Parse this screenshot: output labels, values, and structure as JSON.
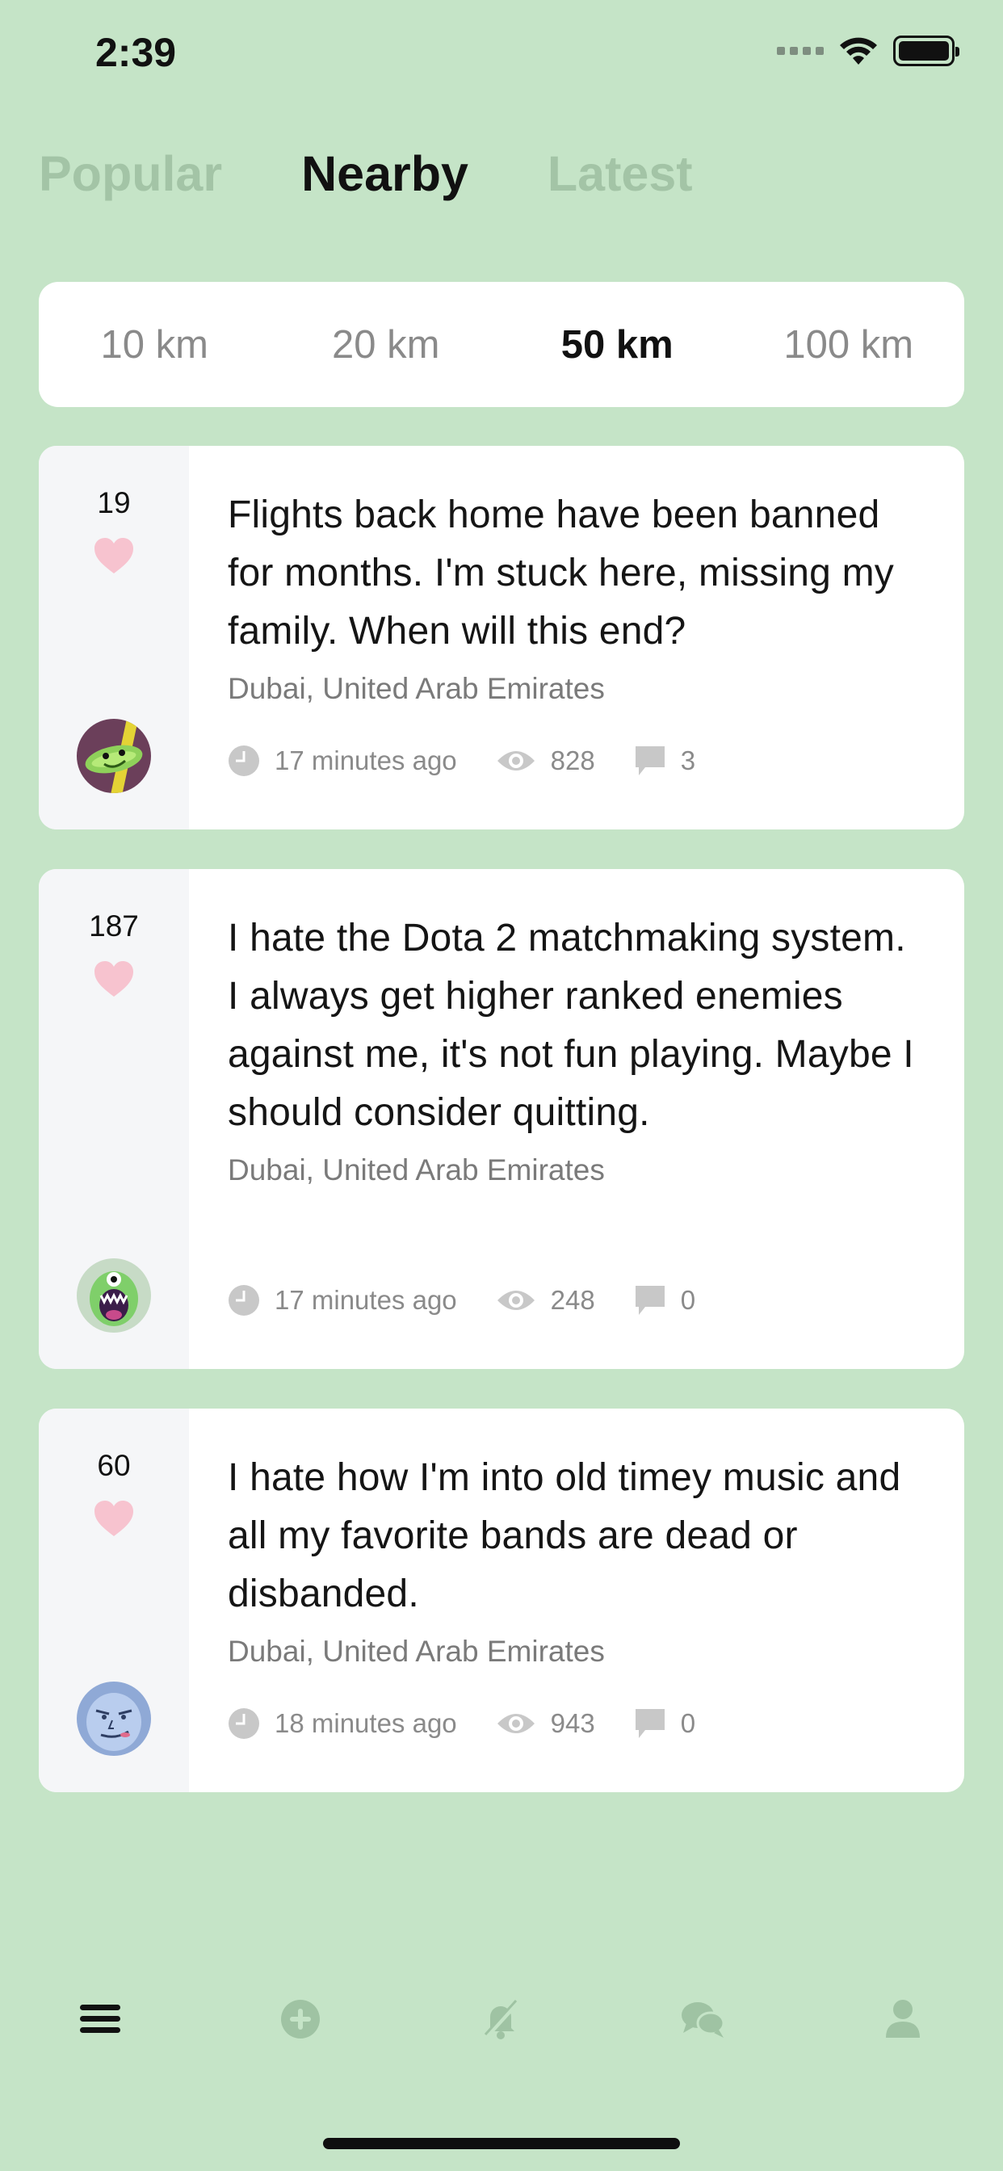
{
  "status_bar": {
    "time": "2:39"
  },
  "top_tabs": [
    {
      "label": "Popular",
      "active": false
    },
    {
      "label": "Nearby",
      "active": true
    },
    {
      "label": "Latest",
      "active": false
    }
  ],
  "distance_filter": {
    "options": [
      {
        "label": "10 km",
        "active": false
      },
      {
        "label": "20 km",
        "active": false
      },
      {
        "label": "50 km",
        "active": true
      },
      {
        "label": "100 km",
        "active": false
      }
    ]
  },
  "posts": [
    {
      "likes": "19",
      "text": "Flights back home have been banned for months. I'm stuck here, missing my family. When will this end?",
      "location": "Dubai, United Arab Emirates",
      "time": "17 minutes ago",
      "views": "828",
      "comments": "3",
      "avatar": "cucumber-avatar"
    },
    {
      "likes": "187",
      "text": "I hate the Dota 2 matchmaking system. I always get higher ranked enemies against me, it's not fun playing. Maybe I should consider quitting.",
      "location": "Dubai, United Arab Emirates",
      "time": "17 minutes ago",
      "views": "248",
      "comments": "0",
      "avatar": "screaming-monster-avatar"
    },
    {
      "likes": "60",
      "text": "I hate how I'm into old timey music and all my favorite bands are dead or disbanded.",
      "location": "Dubai, United Arab Emirates",
      "time": "18 minutes ago",
      "views": "943",
      "comments": "0",
      "avatar": "smirk-face-avatar"
    }
  ],
  "tab_bar": {
    "items": [
      "menu-icon",
      "add-icon",
      "notifications-off-icon",
      "chat-icon",
      "profile-icon"
    ],
    "active": "menu-icon"
  },
  "colors": {
    "background": "#c5e4c7",
    "inactive_tab": "#a3c4a6",
    "heart": "#f7c3cf",
    "meta_icon": "#c8c8c8",
    "tab_icon_inactive": "#9fc3a3"
  }
}
